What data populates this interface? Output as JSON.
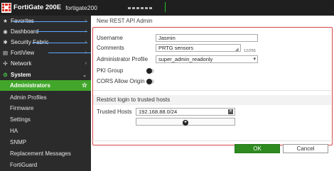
{
  "topbar": {
    "product": "FortiGate 200E",
    "hostname": "fortigate200"
  },
  "sidebar": {
    "items": [
      {
        "label": "Favorites",
        "icon": "star-icon"
      },
      {
        "label": "Dashboard",
        "icon": "dashboard-icon"
      },
      {
        "label": "Security Fabric",
        "icon": "fabric-icon"
      },
      {
        "label": "FortiView",
        "icon": "chart-icon"
      },
      {
        "label": "Network",
        "icon": "network-icon"
      },
      {
        "label": "System",
        "icon": "gear-icon"
      }
    ],
    "system_subitems": [
      {
        "label": "Administrators",
        "active": true
      },
      {
        "label": "Admin Profiles"
      },
      {
        "label": "Firmware"
      },
      {
        "label": "Settings"
      },
      {
        "label": "HA"
      },
      {
        "label": "SNMP"
      },
      {
        "label": "Replacement Messages"
      },
      {
        "label": "FortiGuard"
      }
    ],
    "accent": "#41a62a"
  },
  "page": {
    "title": "New REST API Admin"
  },
  "form": {
    "username": {
      "label": "Username",
      "value": "Jasmin"
    },
    "comments": {
      "label": "Comments",
      "value": "PRTG sensors",
      "counter": "12/255"
    },
    "profile": {
      "label": "Administrator Profile",
      "value": "super_admin_readonly"
    },
    "pki_group": {
      "label": "PKI Group"
    },
    "cors": {
      "label": "CORS Allow Origin"
    },
    "trusted_section": {
      "title": "Restrict login to trusted hosts"
    },
    "trusted_hosts": {
      "label": "Trusted Hosts",
      "value": "192.168.88.0/24"
    }
  },
  "buttons": {
    "ok": "OK",
    "cancel": "Cancel"
  },
  "colors": {
    "ok_button": "#2f8a20",
    "dialog_border": "#d64545",
    "topbar": "#1f1f1f"
  }
}
